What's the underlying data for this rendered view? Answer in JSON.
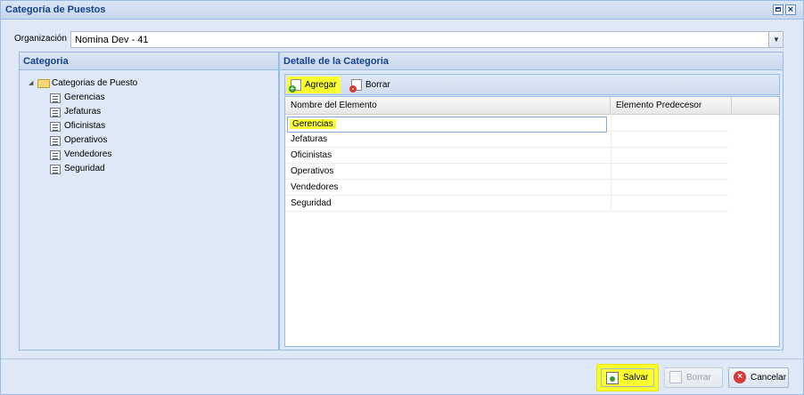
{
  "window": {
    "title": "Categoría de Puestos"
  },
  "organization": {
    "label": "Organización",
    "value": "Nomina Dev - 41"
  },
  "left_panel": {
    "title": "Categoria",
    "tree": {
      "root": "Categorias de Puesto",
      "children": [
        "Gerencias",
        "Jefaturas",
        "Oficinistas",
        "Operativos",
        "Vendedores",
        "Seguridad"
      ]
    }
  },
  "right_panel": {
    "title": "Detalle de la Categoria",
    "toolbar": {
      "add_label": "Agregar",
      "delete_label": "Borrar"
    },
    "grid": {
      "columns": [
        "Nombre del Elemento",
        "Elemento Predecesor"
      ],
      "rows": [
        {
          "name": "Gerencias",
          "predecessor": ""
        },
        {
          "name": "Jefaturas",
          "predecessor": ""
        },
        {
          "name": "Oficinistas",
          "predecessor": ""
        },
        {
          "name": "Operativos",
          "predecessor": ""
        },
        {
          "name": "Vendedores",
          "predecessor": ""
        },
        {
          "name": "Seguridad",
          "predecessor": ""
        }
      ]
    }
  },
  "footer": {
    "save_label": "Salvar",
    "delete_label": "Borrar",
    "cancel_label": "Cancelar"
  },
  "colors": {
    "highlight": "#fbff2f",
    "header_text": "#15428b",
    "panel_bg": "#dfe8f6",
    "border": "#99bbe8"
  }
}
